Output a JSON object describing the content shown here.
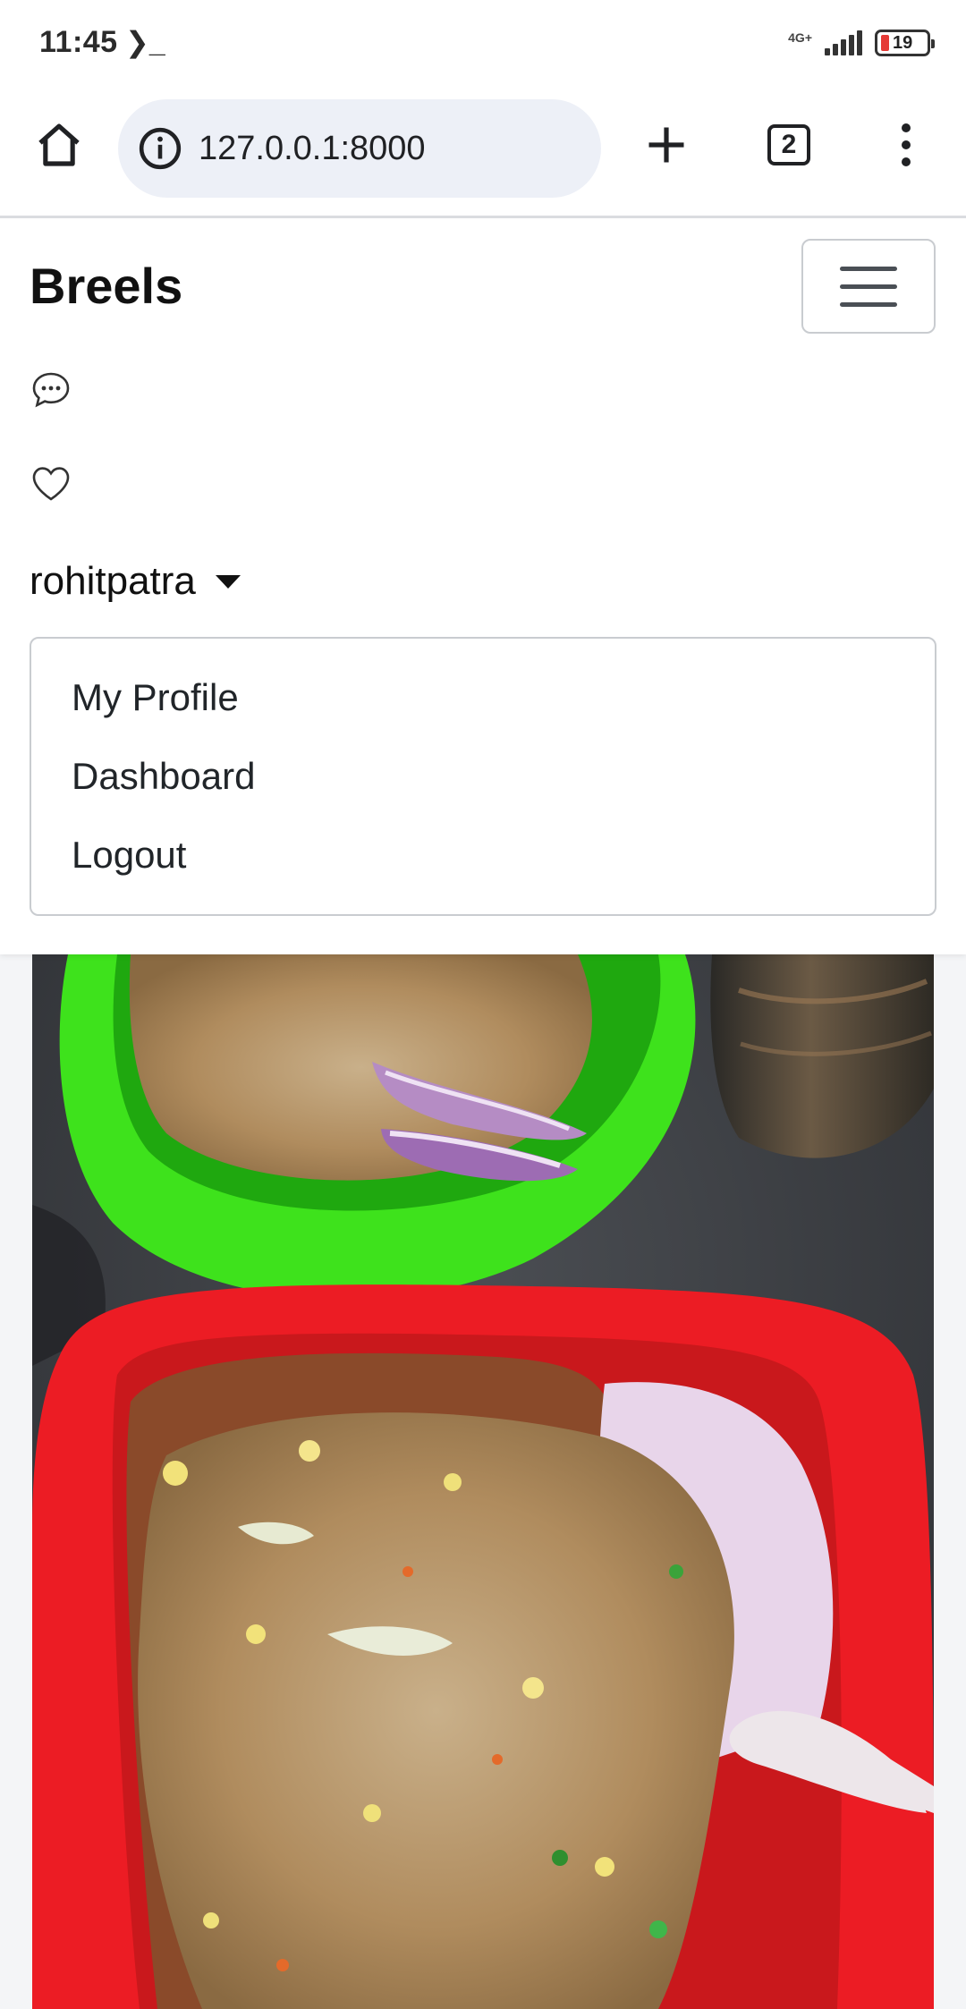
{
  "status_bar": {
    "time": "11:45",
    "terminal_glyph": "❯_",
    "network": "4G+",
    "battery": "19"
  },
  "browser": {
    "url": "127.0.0.1:8000",
    "tab_count": "2"
  },
  "navbar": {
    "brand": "Breels",
    "username": "rohitpatra",
    "menu": [
      "My Profile",
      "Dashboard",
      "Logout"
    ]
  },
  "colors": {
    "bowl_green": "#3ee21c",
    "plate_red": "#ec1c24",
    "page_bg": "#f4f5f7"
  },
  "icons": [
    "home-icon",
    "info-icon",
    "plus-icon",
    "tabs-icon",
    "more-icon",
    "chat-icon",
    "heart-icon",
    "menu-icon"
  ]
}
